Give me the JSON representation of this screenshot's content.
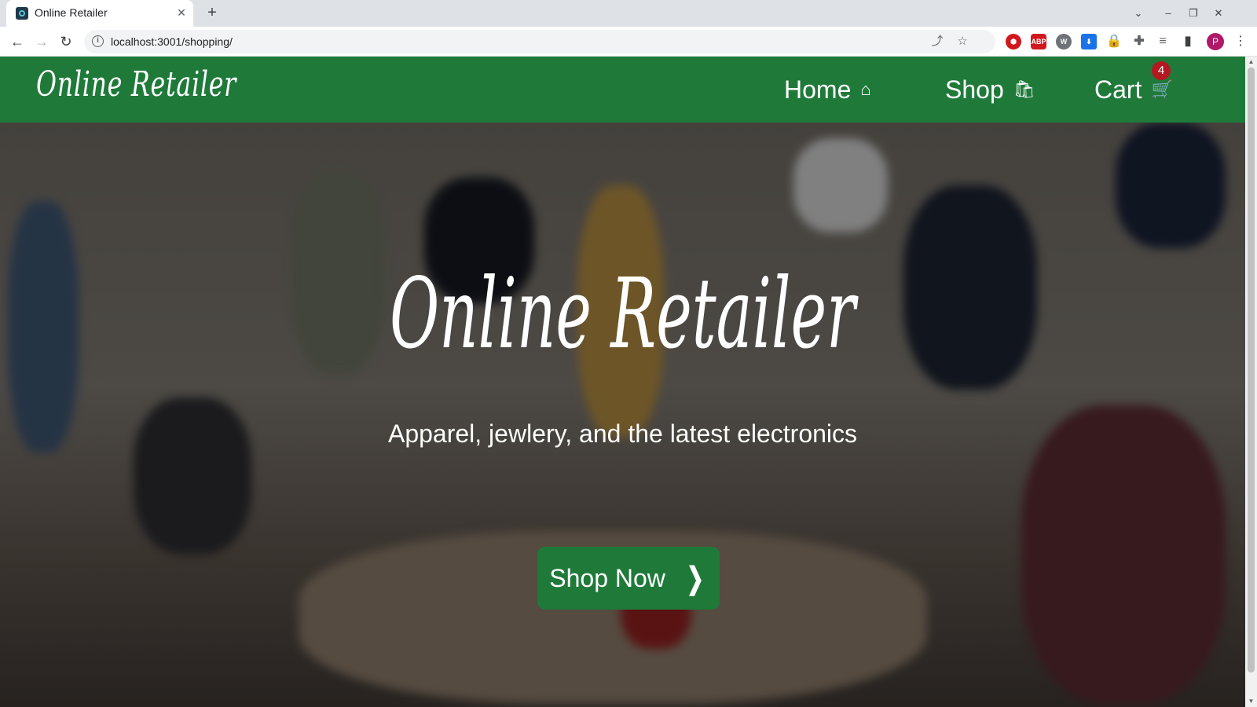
{
  "browser": {
    "tab_title": "Online Retailer",
    "tab_close": "✕",
    "new_tab": "+",
    "url": "localhost:3001/shopping/",
    "window_controls": [
      "⌄",
      "–",
      "❐",
      "✕"
    ],
    "profile_initial": "P",
    "extensions": [
      "ABP"
    ]
  },
  "site": {
    "brand": "Online Retailer",
    "nav": [
      {
        "label": "Home",
        "icon": "home-icon",
        "glyph": "⌂"
      },
      {
        "label": "Shop",
        "icon": "shopping-bag-icon",
        "glyph": "🛍"
      },
      {
        "label": "Cart",
        "icon": "cart-icon",
        "glyph": "🛒"
      }
    ],
    "cart_count": "4",
    "accent_color": "#1f7a3a",
    "badge_color": "#b41820"
  },
  "hero": {
    "title": "Online Retailer",
    "subtitle": "Apparel, jewlery, and the latest electronics",
    "cta_label": "Shop Now",
    "cta_icon": "chevron-right-icon"
  }
}
